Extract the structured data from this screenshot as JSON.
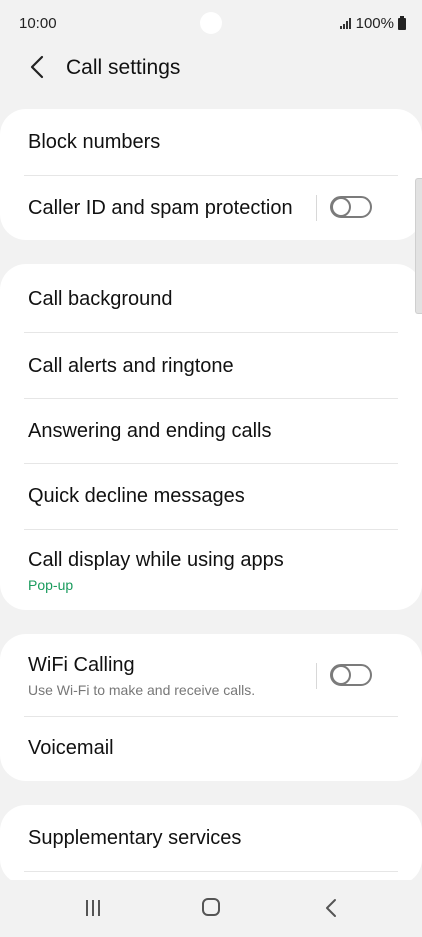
{
  "status": {
    "time": "10:00",
    "battery": "100%"
  },
  "header": {
    "title": "Call settings"
  },
  "cards": [
    {
      "items": [
        {
          "label": "Block numbers"
        },
        {
          "label": "Caller ID and spam protection",
          "toggle": "off"
        }
      ]
    },
    {
      "items": [
        {
          "label": "Call background"
        },
        {
          "label": "Call alerts and ringtone"
        },
        {
          "label": "Answering and ending calls"
        },
        {
          "label": "Quick decline messages"
        },
        {
          "label": "Call display while using apps",
          "sub": "Pop-up"
        }
      ]
    },
    {
      "items": [
        {
          "label": "WiFi Calling",
          "sub": "Use Wi-Fi to make and receive calls.",
          "toggle": "off"
        },
        {
          "label": "Voicemail"
        }
      ]
    },
    {
      "items": [
        {
          "label": "Supplementary services"
        }
      ]
    }
  ],
  "colors": {
    "accent_sub": "#1a9b5d",
    "muted_sub": "#777777",
    "background": "#f2f2f2",
    "card": "#ffffff"
  },
  "icons": {
    "back": "chevron-left-icon",
    "recent": "recent-apps-icon",
    "home": "home-icon",
    "nav_back": "nav-back-icon"
  }
}
